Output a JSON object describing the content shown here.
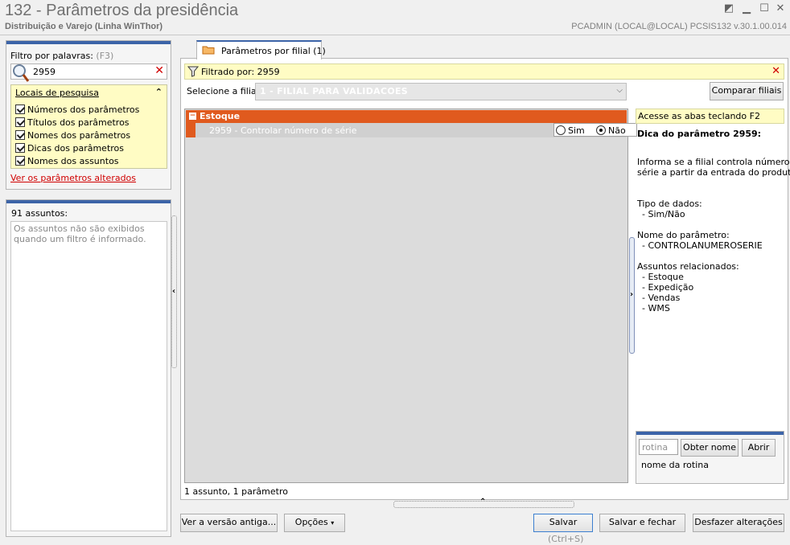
{
  "window": {
    "title": "132 - Parâmetros da presidência",
    "subtitle": "Distribuição e Varejo (Linha WinThor)",
    "user_info": "PCADMIN (LOCAL@LOCAL)   PCSIS132  v.30.1.00.014"
  },
  "filter": {
    "label": "Filtro por palavras:",
    "shortcut": "(F3)",
    "search_value": "2959",
    "locais_title": "Locais de pesquisa",
    "checkboxes": [
      "Números dos parâmetros",
      "Títulos dos parâmetros",
      "Nomes dos parâmetros",
      "Dicas dos parâmetros",
      "Nomes dos assuntos"
    ],
    "altered_link": "Ver os parâmetros alterados"
  },
  "subjects": {
    "count_label": "91 assuntos:",
    "message": "Os assuntos não são exibidos quando um filtro é informado."
  },
  "tab": {
    "label": "Parâmetros por filial  (1)"
  },
  "filtered_bar": {
    "text": "Filtrado por: 2959"
  },
  "filial": {
    "label": "Selecione a filial:",
    "value": "1 - FILIAL PARA VALIDACOES",
    "compare_button": "Comparar filiais"
  },
  "grid": {
    "group": "Estoque",
    "param_label": "2959 - Controlar número de série",
    "option_yes": "Sim",
    "option_no": "Não",
    "selected": "Não",
    "status": "1 assunto, 1 parâmetro"
  },
  "help": {
    "tip": "Acesse as abas teclando F2",
    "title": "Dica do parâmetro 2959:",
    "description_1": "Informa se a filial controla número de",
    "description_2": "série a partir da entrada do produto.",
    "data_type_label": "Tipo de dados:",
    "data_type_value": "- Sim/Não",
    "param_name_label": "Nome do parâmetro:",
    "param_name_value": "- CONTROLANUMEROSERIE",
    "related_label": "Assuntos relacionados:",
    "related": [
      "- Estoque",
      "- Expedição",
      "- Vendas",
      "- WMS"
    ]
  },
  "rotina": {
    "placeholder": "rotina",
    "obter_button": "Obter nome",
    "abrir_button": "Abrir",
    "caption": "nome da rotina"
  },
  "bottom": {
    "old_version_button": "Ver a versão antiga...",
    "options_button": "Opções",
    "save_button": "Salvar",
    "save_hint": "(Ctrl+S)",
    "save_close_button": "Salvar e fechar",
    "undo_button": "Desfazer alterações"
  },
  "colors": {
    "accent_blue": "#3c64a8",
    "group_orange": "#e05a1e",
    "tip_yellow": "#fffcc4",
    "link_red": "#d00000"
  }
}
